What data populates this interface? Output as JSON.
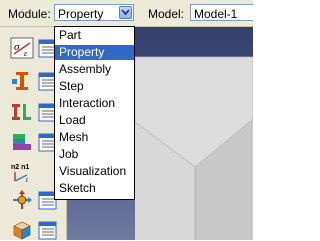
{
  "context_bar": {
    "module_label": "Module:",
    "module_value": "Property",
    "model_label": "Model:",
    "model_value": "Model-1"
  },
  "module_dropdown": {
    "items": [
      "Part",
      "Property",
      "Assembly",
      "Step",
      "Interaction",
      "Load",
      "Mesh",
      "Job",
      "Visualization",
      "Sketch"
    ],
    "selected_index": 1
  },
  "toolbox": {
    "icons": [
      "create-material-icon",
      "create-section-icon",
      "assign-section-icon",
      "create-profile-icon",
      "special-skin-icon",
      "assign-orientation-icon",
      "assign-beam-orientation-icon",
      "create-inertia-icon"
    ]
  },
  "colors": {
    "selection_highlight": "#316ac5",
    "toolbar_background": "#ece9d8",
    "viewport_background": "#3c4a78"
  }
}
